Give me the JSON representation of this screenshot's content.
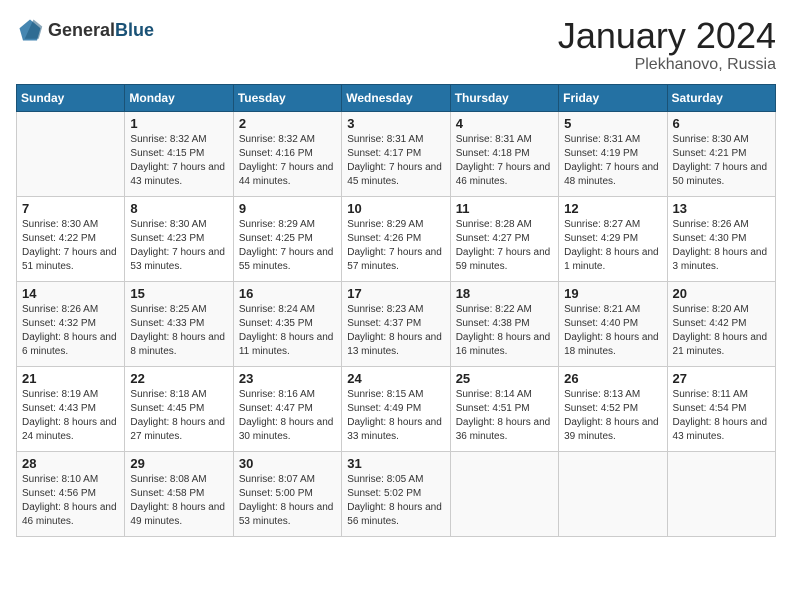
{
  "header": {
    "logo_general": "General",
    "logo_blue": "Blue",
    "month": "January 2024",
    "location": "Plekhanovo, Russia"
  },
  "weekdays": [
    "Sunday",
    "Monday",
    "Tuesday",
    "Wednesday",
    "Thursday",
    "Friday",
    "Saturday"
  ],
  "weeks": [
    [
      {
        "day": "",
        "sunrise": "",
        "sunset": "",
        "daylight": ""
      },
      {
        "day": "1",
        "sunrise": "Sunrise: 8:32 AM",
        "sunset": "Sunset: 4:15 PM",
        "daylight": "Daylight: 7 hours and 43 minutes."
      },
      {
        "day": "2",
        "sunrise": "Sunrise: 8:32 AM",
        "sunset": "Sunset: 4:16 PM",
        "daylight": "Daylight: 7 hours and 44 minutes."
      },
      {
        "day": "3",
        "sunrise": "Sunrise: 8:31 AM",
        "sunset": "Sunset: 4:17 PM",
        "daylight": "Daylight: 7 hours and 45 minutes."
      },
      {
        "day": "4",
        "sunrise": "Sunrise: 8:31 AM",
        "sunset": "Sunset: 4:18 PM",
        "daylight": "Daylight: 7 hours and 46 minutes."
      },
      {
        "day": "5",
        "sunrise": "Sunrise: 8:31 AM",
        "sunset": "Sunset: 4:19 PM",
        "daylight": "Daylight: 7 hours and 48 minutes."
      },
      {
        "day": "6",
        "sunrise": "Sunrise: 8:30 AM",
        "sunset": "Sunset: 4:21 PM",
        "daylight": "Daylight: 7 hours and 50 minutes."
      }
    ],
    [
      {
        "day": "7",
        "sunrise": "Sunrise: 8:30 AM",
        "sunset": "Sunset: 4:22 PM",
        "daylight": "Daylight: 7 hours and 51 minutes."
      },
      {
        "day": "8",
        "sunrise": "Sunrise: 8:30 AM",
        "sunset": "Sunset: 4:23 PM",
        "daylight": "Daylight: 7 hours and 53 minutes."
      },
      {
        "day": "9",
        "sunrise": "Sunrise: 8:29 AM",
        "sunset": "Sunset: 4:25 PM",
        "daylight": "Daylight: 7 hours and 55 minutes."
      },
      {
        "day": "10",
        "sunrise": "Sunrise: 8:29 AM",
        "sunset": "Sunset: 4:26 PM",
        "daylight": "Daylight: 7 hours and 57 minutes."
      },
      {
        "day": "11",
        "sunrise": "Sunrise: 8:28 AM",
        "sunset": "Sunset: 4:27 PM",
        "daylight": "Daylight: 7 hours and 59 minutes."
      },
      {
        "day": "12",
        "sunrise": "Sunrise: 8:27 AM",
        "sunset": "Sunset: 4:29 PM",
        "daylight": "Daylight: 8 hours and 1 minute."
      },
      {
        "day": "13",
        "sunrise": "Sunrise: 8:26 AM",
        "sunset": "Sunset: 4:30 PM",
        "daylight": "Daylight: 8 hours and 3 minutes."
      }
    ],
    [
      {
        "day": "14",
        "sunrise": "Sunrise: 8:26 AM",
        "sunset": "Sunset: 4:32 PM",
        "daylight": "Daylight: 8 hours and 6 minutes."
      },
      {
        "day": "15",
        "sunrise": "Sunrise: 8:25 AM",
        "sunset": "Sunset: 4:33 PM",
        "daylight": "Daylight: 8 hours and 8 minutes."
      },
      {
        "day": "16",
        "sunrise": "Sunrise: 8:24 AM",
        "sunset": "Sunset: 4:35 PM",
        "daylight": "Daylight: 8 hours and 11 minutes."
      },
      {
        "day": "17",
        "sunrise": "Sunrise: 8:23 AM",
        "sunset": "Sunset: 4:37 PM",
        "daylight": "Daylight: 8 hours and 13 minutes."
      },
      {
        "day": "18",
        "sunrise": "Sunrise: 8:22 AM",
        "sunset": "Sunset: 4:38 PM",
        "daylight": "Daylight: 8 hours and 16 minutes."
      },
      {
        "day": "19",
        "sunrise": "Sunrise: 8:21 AM",
        "sunset": "Sunset: 4:40 PM",
        "daylight": "Daylight: 8 hours and 18 minutes."
      },
      {
        "day": "20",
        "sunrise": "Sunrise: 8:20 AM",
        "sunset": "Sunset: 4:42 PM",
        "daylight": "Daylight: 8 hours and 21 minutes."
      }
    ],
    [
      {
        "day": "21",
        "sunrise": "Sunrise: 8:19 AM",
        "sunset": "Sunset: 4:43 PM",
        "daylight": "Daylight: 8 hours and 24 minutes."
      },
      {
        "day": "22",
        "sunrise": "Sunrise: 8:18 AM",
        "sunset": "Sunset: 4:45 PM",
        "daylight": "Daylight: 8 hours and 27 minutes."
      },
      {
        "day": "23",
        "sunrise": "Sunrise: 8:16 AM",
        "sunset": "Sunset: 4:47 PM",
        "daylight": "Daylight: 8 hours and 30 minutes."
      },
      {
        "day": "24",
        "sunrise": "Sunrise: 8:15 AM",
        "sunset": "Sunset: 4:49 PM",
        "daylight": "Daylight: 8 hours and 33 minutes."
      },
      {
        "day": "25",
        "sunrise": "Sunrise: 8:14 AM",
        "sunset": "Sunset: 4:51 PM",
        "daylight": "Daylight: 8 hours and 36 minutes."
      },
      {
        "day": "26",
        "sunrise": "Sunrise: 8:13 AM",
        "sunset": "Sunset: 4:52 PM",
        "daylight": "Daylight: 8 hours and 39 minutes."
      },
      {
        "day": "27",
        "sunrise": "Sunrise: 8:11 AM",
        "sunset": "Sunset: 4:54 PM",
        "daylight": "Daylight: 8 hours and 43 minutes."
      }
    ],
    [
      {
        "day": "28",
        "sunrise": "Sunrise: 8:10 AM",
        "sunset": "Sunset: 4:56 PM",
        "daylight": "Daylight: 8 hours and 46 minutes."
      },
      {
        "day": "29",
        "sunrise": "Sunrise: 8:08 AM",
        "sunset": "Sunset: 4:58 PM",
        "daylight": "Daylight: 8 hours and 49 minutes."
      },
      {
        "day": "30",
        "sunrise": "Sunrise: 8:07 AM",
        "sunset": "Sunset: 5:00 PM",
        "daylight": "Daylight: 8 hours and 53 minutes."
      },
      {
        "day": "31",
        "sunrise": "Sunrise: 8:05 AM",
        "sunset": "Sunset: 5:02 PM",
        "daylight": "Daylight: 8 hours and 56 minutes."
      },
      {
        "day": "",
        "sunrise": "",
        "sunset": "",
        "daylight": ""
      },
      {
        "day": "",
        "sunrise": "",
        "sunset": "",
        "daylight": ""
      },
      {
        "day": "",
        "sunrise": "",
        "sunset": "",
        "daylight": ""
      }
    ]
  ]
}
